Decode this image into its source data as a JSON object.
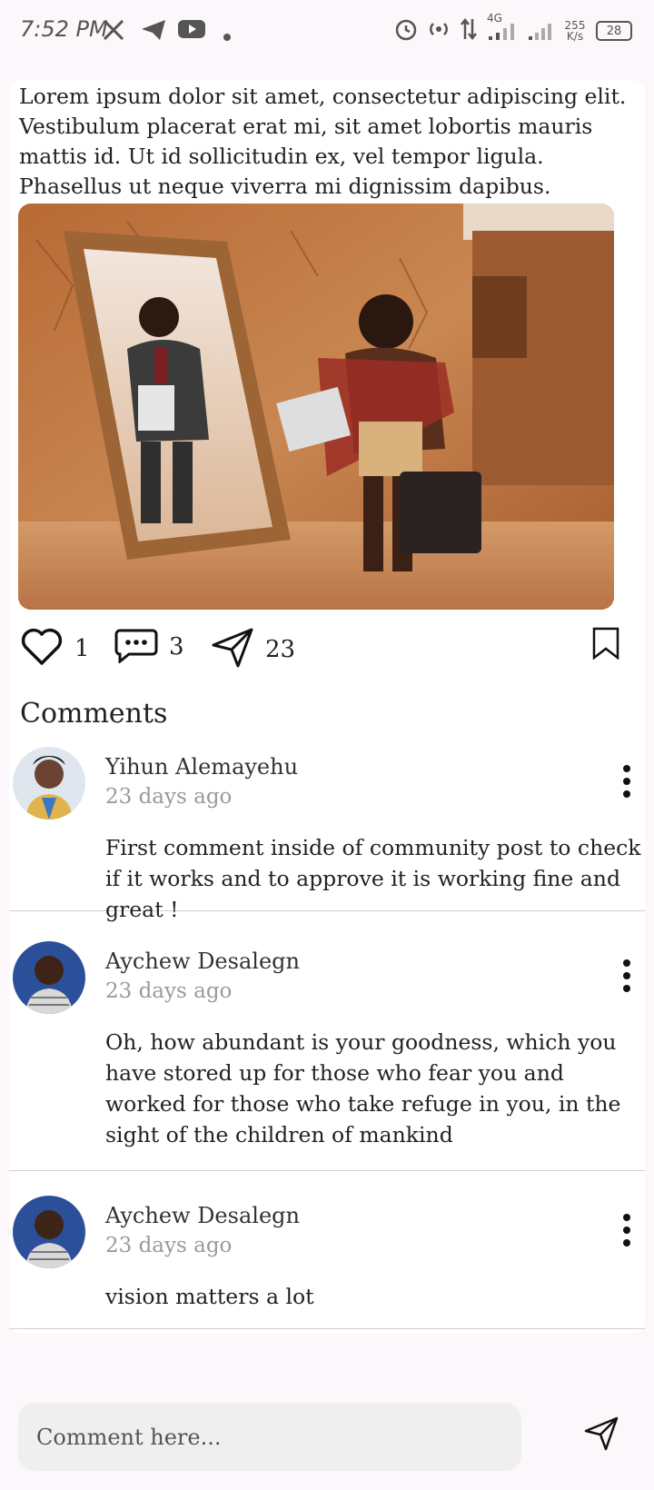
{
  "status_bar": {
    "time": "7:52 PM",
    "network_type": "4G",
    "speed": "255 K/s",
    "battery": "28",
    "left_icons": [
      "x-icon",
      "telegram-icon",
      "youtube-icon",
      "dot-icon"
    ],
    "right_icons": [
      "alarm-icon",
      "hotspot-icon",
      "data-arrows-icon",
      "signal-icon",
      "signal-icon",
      "battery-icon"
    ]
  },
  "post": {
    "text": "Lorem ipsum dolor sit amet, consectetur adipiscing elit. Vestibulum placerat erat mi, sit amet lobortis mauris mattis id. Ut id sollicitudin ex, vel tempor ligula. Phasellus ut neque viverra mi dignissim dapibus.",
    "likes": "1",
    "comments": "3",
    "shares": "23"
  },
  "comments_section": {
    "title": "Comments",
    "items": [
      {
        "author": "Yihun Alemayehu",
        "time": "23 days ago",
        "body": "First comment inside of community post to check if it works and to approve it is working fine and great !"
      },
      {
        "author": "Aychew Desalegn",
        "time": "23 days ago",
        "body": "Oh, how abundant is your goodness, which you have stored up for those who fear you and worked for those who take refuge in you, in the sight of the children of mankind"
      },
      {
        "author": "Aychew Desalegn",
        "time": "23 days ago",
        "body": "vision matters a lot"
      }
    ]
  },
  "comment_input": {
    "placeholder": "Comment here..."
  },
  "colors": {
    "background": "#fbf7fb",
    "card": "#ffffff",
    "muted_text": "#9a9a9a",
    "input_bg": "#efefef"
  }
}
